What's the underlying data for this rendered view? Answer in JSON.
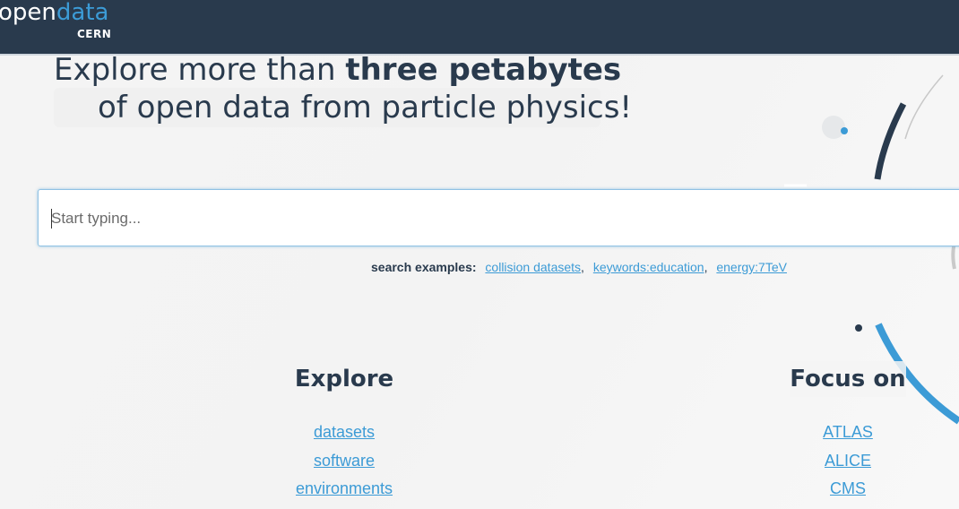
{
  "header": {
    "logo_open": "open",
    "logo_data": "data",
    "logo_sub": "CERN"
  },
  "hero": {
    "line1_prefix": "Explore more than ",
    "line1_bold": "three petabytes",
    "line2": "of open data from particle physics!"
  },
  "search": {
    "placeholder": "Start typing...",
    "value": ""
  },
  "examples": {
    "label": "search examples:",
    "items": [
      "collision datasets",
      "keywords:education",
      "energy:7TeV"
    ],
    "separator": ","
  },
  "explore": {
    "title": "Explore",
    "links": [
      "datasets",
      "software",
      "environments"
    ]
  },
  "focus": {
    "title": "Focus on",
    "links": [
      "ATLAS",
      "ALICE",
      "CMS"
    ]
  },
  "colors": {
    "navbar": "#293a4d",
    "accent": "#3c9bd6",
    "text": "#293a4d"
  },
  "icons": {
    "decoration": "particle-track-decoration"
  }
}
